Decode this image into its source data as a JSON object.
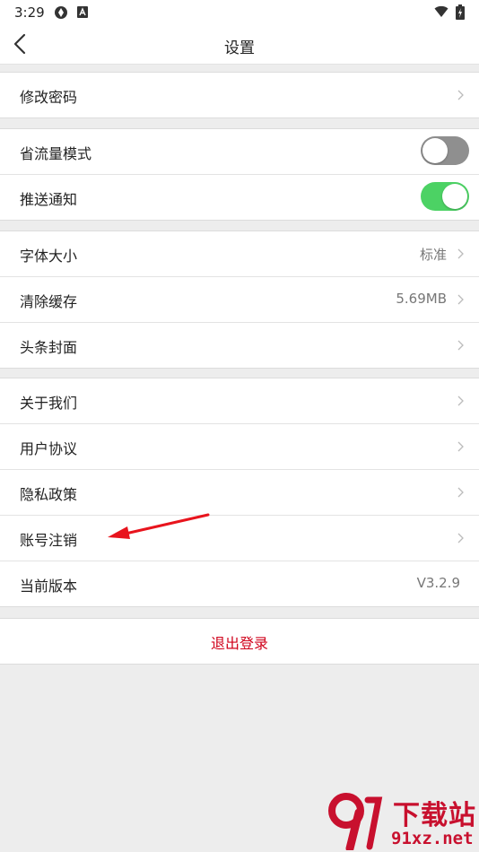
{
  "status_bar": {
    "time": "3:29"
  },
  "header": {
    "title": "设置",
    "back_icon": "chevron-left-icon"
  },
  "groups": {
    "account": {
      "change_password": "修改密码"
    },
    "toggles": {
      "data_saver": {
        "label": "省流量模式",
        "state": "off"
      },
      "push": {
        "label": "推送通知",
        "state": "on"
      }
    },
    "display": {
      "font_size": {
        "label": "字体大小",
        "value": "标准"
      },
      "clear_cache": {
        "label": "清除缓存",
        "value": "5.69MB"
      },
      "headline_cover": {
        "label": "头条封面"
      }
    },
    "about": {
      "about_us": "关于我们",
      "user_agreement": "用户协议",
      "privacy_policy": "隐私政策",
      "account_cancel": "账号注销",
      "version": {
        "label": "当前版本",
        "value": "V3.2.9"
      }
    }
  },
  "logout": {
    "label": "退出登录"
  },
  "watermark": {
    "line1": "下载站",
    "line2": "91xz.net"
  },
  "colors": {
    "toggle_on": "#4cd264",
    "toggle_off": "#8f8f8f",
    "logout": "#d0021b",
    "annotation_arrow": "#e8141d"
  }
}
